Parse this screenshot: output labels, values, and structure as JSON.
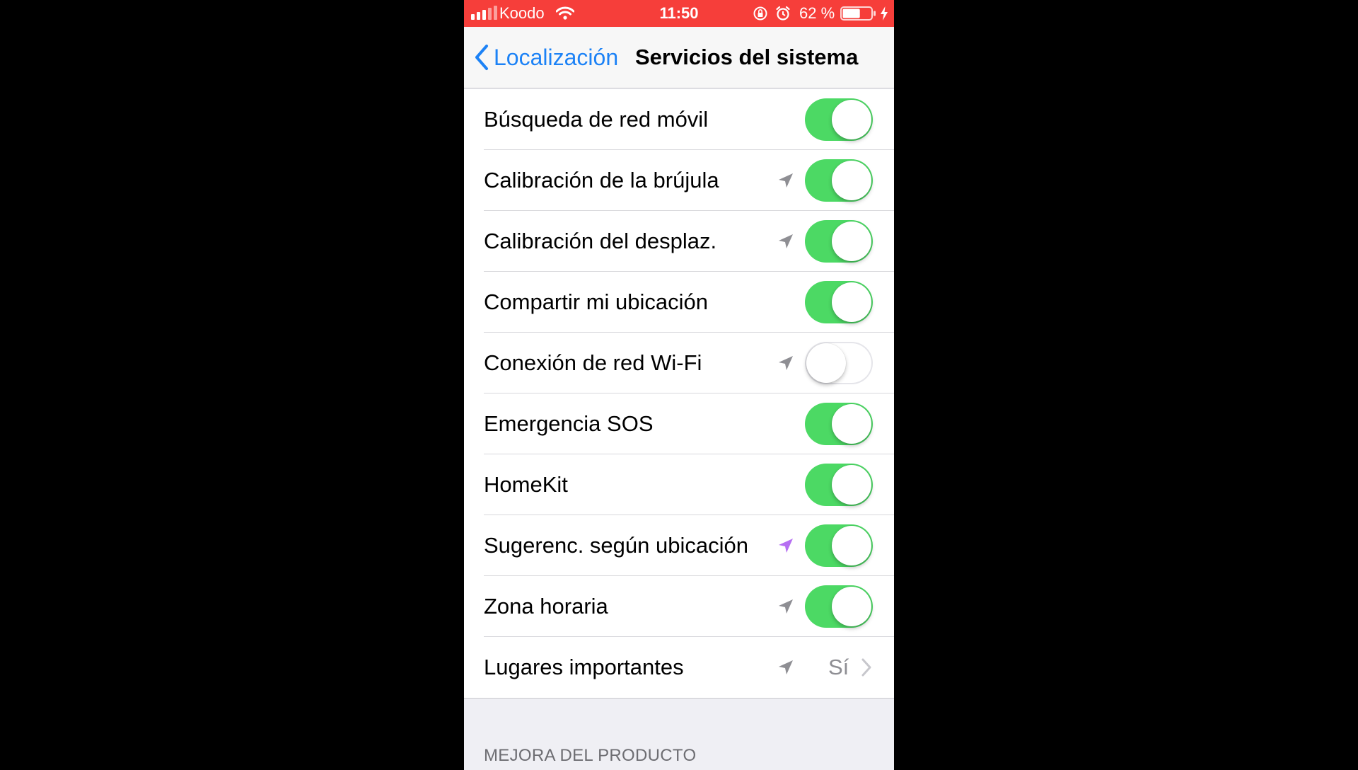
{
  "status_bar": {
    "carrier": "Koodo",
    "time": "11:50",
    "battery_percent": "62 %",
    "battery_level": 0.62,
    "icons": [
      "signal-icon",
      "wifi-icon",
      "rotation-lock-icon",
      "alarm-icon",
      "battery-icon",
      "charging-bolt-icon"
    ],
    "background_color": "#f63e3a"
  },
  "nav": {
    "back_label": "Localización",
    "title": "Servicios del sistema",
    "accent_color": "#1c82f6"
  },
  "rows": [
    {
      "label": "Búsqueda de red móvil",
      "location_icon": "none",
      "enabled": true
    },
    {
      "label": "Calibración de la brújula",
      "location_icon": "gray",
      "enabled": true
    },
    {
      "label": "Calibración del desplaz.",
      "location_icon": "gray",
      "enabled": true
    },
    {
      "label": "Compartir mi ubicación",
      "location_icon": "none",
      "enabled": true
    },
    {
      "label": "Conexión de red Wi-Fi",
      "location_icon": "gray",
      "enabled": false
    },
    {
      "label": "Emergencia SOS",
      "location_icon": "none",
      "enabled": true
    },
    {
      "label": "HomeKit",
      "location_icon": "none",
      "enabled": true
    },
    {
      "label": "Sugerenc. según ubicación",
      "location_icon": "purple",
      "enabled": true
    },
    {
      "label": "Zona horaria",
      "location_icon": "gray",
      "enabled": true
    }
  ],
  "detail_row": {
    "label": "Lugares importantes",
    "location_icon": "gray",
    "value": "Sí"
  },
  "section_header": "MEJORA DEL PRODUCTO",
  "colors": {
    "toggle_on": "#4cd964",
    "location_gray": "#8e8e93",
    "location_purple": "#b66ff2"
  }
}
